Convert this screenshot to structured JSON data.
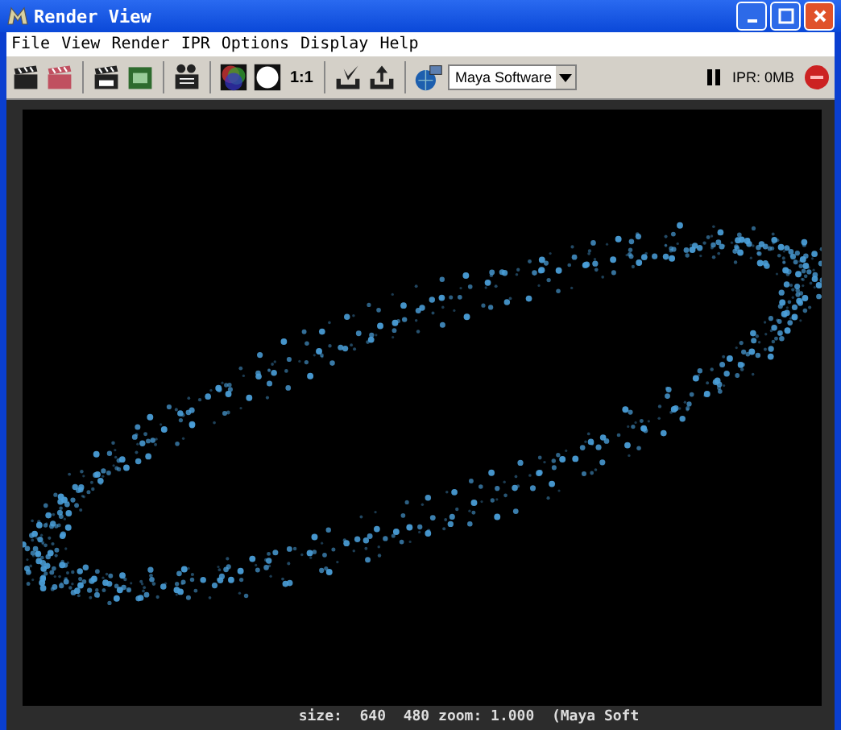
{
  "window": {
    "title": "Render View"
  },
  "menu": [
    "File",
    "View",
    "Render",
    "IPR",
    "Options",
    "Display",
    "Help"
  ],
  "toolbar": [
    {
      "kind": "clapper"
    },
    {
      "kind": "clapper-red"
    },
    {
      "kind": "sep"
    },
    {
      "kind": "clapper-ipr"
    },
    {
      "kind": "region"
    },
    {
      "kind": "sep"
    },
    {
      "kind": "snapshot"
    },
    {
      "kind": "sep"
    },
    {
      "kind": "rgb"
    },
    {
      "kind": "alpha"
    },
    {
      "kind": "ratio",
      "text": "1:1"
    },
    {
      "kind": "sep"
    },
    {
      "kind": "keep"
    },
    {
      "kind": "remove"
    },
    {
      "kind": "sep"
    },
    {
      "kind": "globe"
    },
    {
      "kind": "dropdown",
      "value": "Maya Software"
    }
  ],
  "ipr": {
    "paused": true,
    "text": "IPR: 0MB"
  },
  "status_bar": "size:  640  480 zoom: 1.000  (Maya Soft"
}
